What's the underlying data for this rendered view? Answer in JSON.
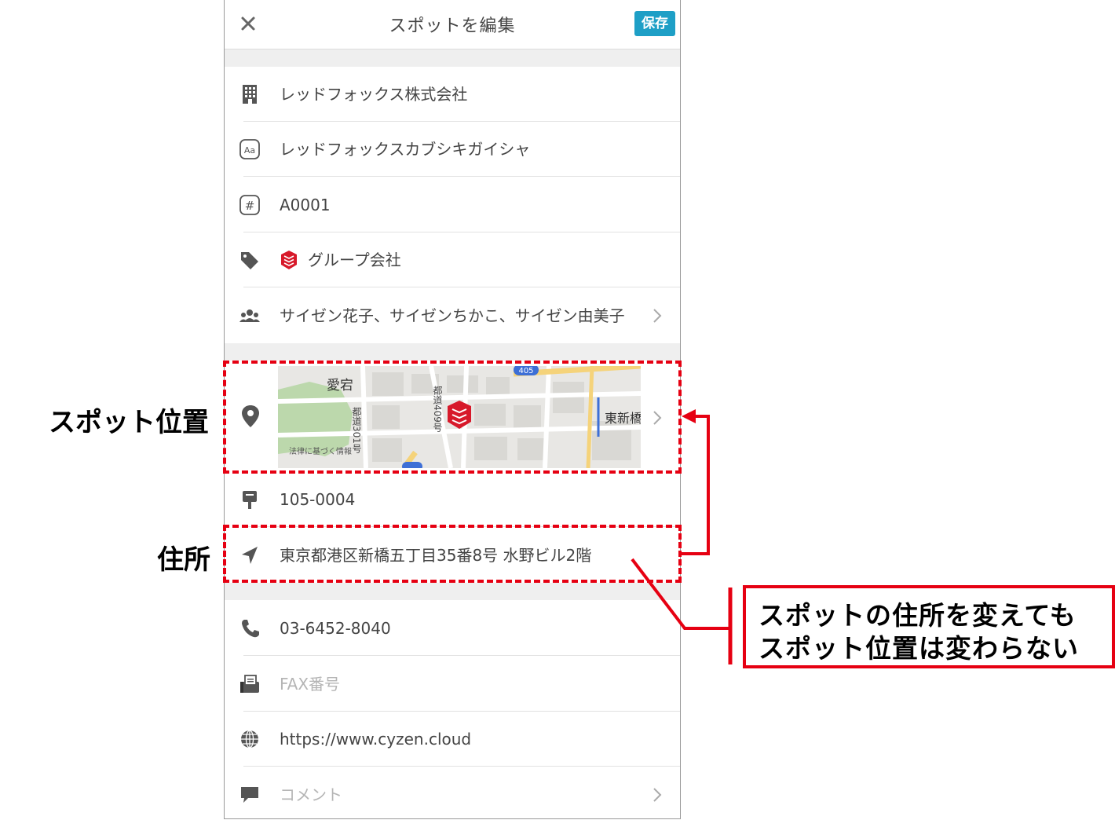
{
  "header": {
    "title": "スポットを編集",
    "save_label": "保存"
  },
  "fields": {
    "company_name": "レッドフォックス株式会社",
    "company_kana": "レッドフォックスカブシキガイシャ",
    "code": "A0001",
    "group": "グループ会社",
    "members": "サイゼン花子、サイゼンちかこ、サイゼン由美子",
    "postal_code": "105-0004",
    "address": "東京都港区新橋五丁目35番8号 水野ビル2階",
    "phone": "03-6452-8040",
    "fax_placeholder": "FAX番号",
    "url": "https://www.cyzen.cloud",
    "comment_placeholder": "コメント"
  },
  "map": {
    "labels": {
      "atago": "愛宕",
      "higashi_shinbashi": "東新橋",
      "route_405": "405",
      "road_409": "都道409号",
      "road_301": "都道301号",
      "legal": "法律に基づく情報"
    }
  },
  "annotations": {
    "spot_position": "スポット位置",
    "address": "住所",
    "note_line1": "スポットの住所を変えても",
    "note_line2": "スポット位置は変わらない",
    "color": "#e60012"
  }
}
